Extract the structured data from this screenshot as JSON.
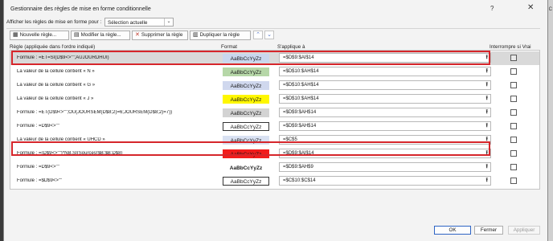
{
  "title": "Gestionnaire des règles de mise en forme conditionnelle",
  "right_edge_text": "C",
  "help": "?",
  "close": "✕",
  "show_rules_label": "Afficher les règles de mise en forme pour :",
  "show_rules_value": "Sélection actuelle",
  "toolbar": {
    "new_rule": "Nouvelle règle...",
    "edit_rule": "Modifier la règle...",
    "delete_rule": "Supprimer la règle",
    "duplicate_rule": "Dupliquer la règle"
  },
  "columns": {
    "rule": "Règle (appliquée dans l'ordre indiqué)",
    "format": "Format",
    "applies_to": "S'applique à",
    "stop_if_true": "Interrompre si Vrai"
  },
  "preview_text": "AaBbCcYyZz",
  "rules": [
    {
      "rule": "Formule : =ET=SI(D$9<>\"\";AUJOURDHUI)",
      "applies": "=$D$9:$AI$14",
      "fill": "#c9d7ee",
      "bold": false,
      "bordered": false,
      "selected": true
    },
    {
      "rule": "La valeur de la cellule contient « N »",
      "applies": "=$D$10:$AH$14",
      "fill": "#b6d7a8",
      "bold": false,
      "bordered": false,
      "selected": false
    },
    {
      "rule": "La valeur de la cellule contient « G »",
      "applies": "=$D$10:$AH$14",
      "fill": "#d0d8ee",
      "bold": false,
      "bordered": false,
      "selected": false
    },
    {
      "rule": "La valeur de la cellule contient « J »",
      "applies": "=$D$10:$AH$14",
      "fill": "#fff700",
      "bold": false,
      "bordered": false,
      "selected": false
    },
    {
      "rule": "Formule : =ET(D$9<>\"\";OU(JOURSEM(D$8;2)=6;JOURSEM(D$8;2)=7))",
      "applies": "=$D$9:$AH$14",
      "fill": "#d3d3d3",
      "bold": false,
      "bordered": false,
      "selected": false
    },
    {
      "rule": "Formule : =D$9<>\"\"",
      "applies": "=$D$9:$AH$14",
      "fill": "#ffffff",
      "bold": false,
      "bordered": true,
      "selected": false
    },
    {
      "rule": "La valeur de la cellule contient « UHCD »",
      "applies": "=$C$5",
      "fill": "#d9e1f2",
      "bold": false,
      "bordered": false,
      "selected": false
    },
    {
      "rule": "Formule : =(D$9<>\"\")*NB.SI(Sources!$B:$B;D$8)",
      "applies": "=$D$9:$AI$14",
      "fill": "#f21c1c",
      "bold": false,
      "bordered": false,
      "selected": false
    },
    {
      "rule": "Formule : =D$9<>\"\"",
      "applies": "=$D$9:$AH$9",
      "fill": "#ffffff",
      "bold": true,
      "bordered": false,
      "selected": false
    },
    {
      "rule": "Formule : =$D$9<>\"\"",
      "applies": "=$C$10:$C$14",
      "fill": "#ffffff",
      "bold": false,
      "bordered": true,
      "selected": false
    },
    {
      "rule": "Formule : =$F$2<>\"\"",
      "applies": "=$F$2:$AE$5",
      "fill": "#f2f2f2",
      "bold": true,
      "bordered": true,
      "selected": false
    }
  ],
  "buttons": {
    "ok": "OK",
    "close": "Fermer",
    "apply": "Appliquer"
  }
}
